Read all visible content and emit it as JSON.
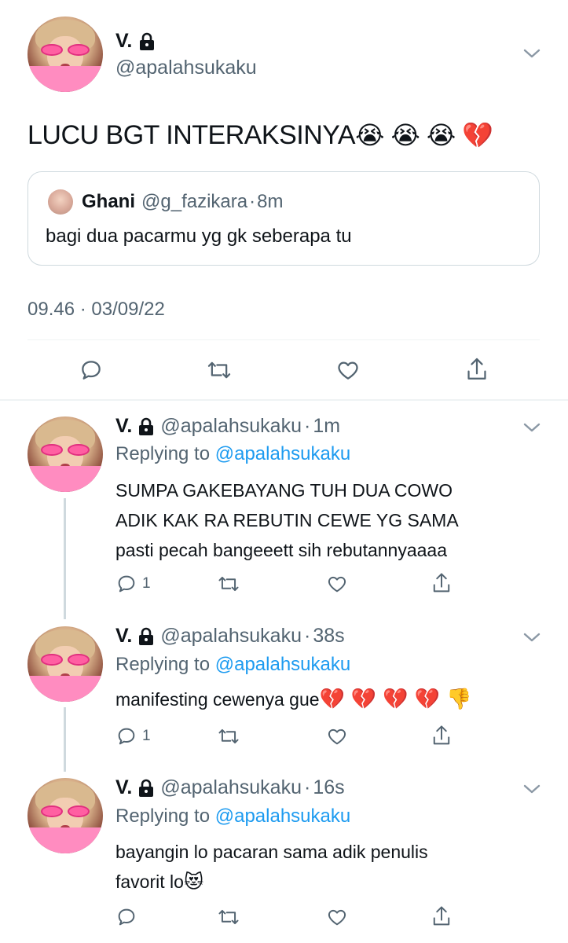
{
  "main_tweet": {
    "name": "V.",
    "handle": "@apalahsukaku",
    "text": "LUCU BGT INTERAKSINYA",
    "emojis": "😭😭😭💔",
    "quote": {
      "name": "Ghani",
      "handle": "@g_fazikara",
      "sep": "·",
      "time": "8m",
      "text": "bagi dua pacarmu yg gk seberapa tu"
    },
    "timestamp": "09.46 · 03/09/22"
  },
  "replies": [
    {
      "name": "V.",
      "handle": "@apalahsukaku",
      "sep": "·",
      "time": "1m",
      "replying_prefix": "Replying to ",
      "replying_to": "@apalahsukaku",
      "lines": [
        "SUMPA GAKEBAYANG TUH DUA COWO",
        "ADIK KAK RA REBUTIN CEWE YG SAMA",
        "pasti pecah bangeeett sih rebutannyaaaa"
      ],
      "reply_count": "1"
    },
    {
      "name": "V.",
      "handle": "@apalahsukaku",
      "sep": "·",
      "time": "38s",
      "replying_prefix": "Replying to ",
      "replying_to": "@apalahsukaku",
      "text": "manifesting cewenya gue",
      "emojis": "💔💔💔💔👎",
      "reply_count": "1"
    },
    {
      "name": "V.",
      "handle": "@apalahsukaku",
      "sep": "·",
      "time": "16s",
      "replying_prefix": "Replying to ",
      "replying_to": "@apalahsukaku",
      "lines": [
        "bayangin lo pacaran sama adik penulis",
        "favorit lo"
      ],
      "emoji_end": "😻",
      "reply_count": ""
    }
  ],
  "colors": {
    "link": "#1d9bf0",
    "gray": "#536471",
    "text": "#0f1419",
    "divider": "#eff3f4"
  },
  "icons": [
    "lock-icon",
    "chevron-down-icon",
    "reply-icon",
    "retweet-icon",
    "like-icon",
    "share-icon"
  ]
}
